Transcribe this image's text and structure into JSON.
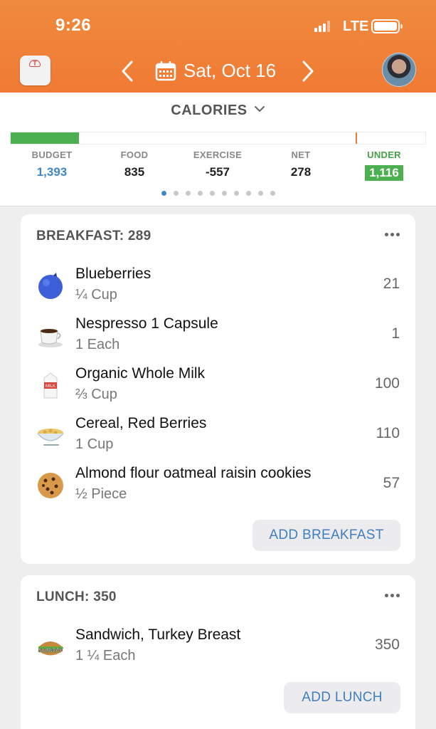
{
  "status_bar": {
    "time": "9:26",
    "network": "LTE"
  },
  "header": {
    "date": "Sat, Oct 16",
    "icons": [
      "scale-icon",
      "chevron-left-icon",
      "calendar-icon",
      "chevron-right-icon",
      "avatar"
    ]
  },
  "summary": {
    "title": "CALORIES",
    "progress_fraction": 0.165,
    "stats": [
      {
        "label": "BUDGET",
        "value": "1,393"
      },
      {
        "label": "FOOD",
        "value": "835"
      },
      {
        "label": "EXERCISE",
        "value": "-557"
      },
      {
        "label": "NET",
        "value": "278"
      },
      {
        "label": "UNDER",
        "value": "1,116"
      }
    ],
    "page_dots": 10,
    "active_dot": 0
  },
  "breakfast": {
    "title": "BREAKFAST: 289",
    "items": [
      {
        "name": "Blueberries",
        "serving": "¼ Cup",
        "calories": "21",
        "icon": "blueberry-icon"
      },
      {
        "name": "Nespresso 1 Capsule",
        "serving": "1 Each",
        "calories": "1",
        "icon": "coffee-cup-icon"
      },
      {
        "name": "Organic Whole Milk",
        "serving": "⅔ Cup",
        "calories": "100",
        "icon": "milk-carton-icon"
      },
      {
        "name": "Cereal, Red Berries",
        "serving": "1 Cup",
        "calories": "110",
        "icon": "cereal-bowl-icon"
      },
      {
        "name": "Almond flour oatmeal raisin cookies",
        "serving": "½ Piece",
        "calories": "57",
        "icon": "cookie-icon"
      }
    ],
    "add_label": "ADD BREAKFAST"
  },
  "lunch": {
    "title": "LUNCH: 350",
    "items": [
      {
        "name": "Sandwich, Turkey Breast",
        "serving": "1 ¼ Each",
        "calories": "350",
        "icon": "sandwich-icon"
      }
    ],
    "add_label": "ADD LUNCH",
    "brand_text": "SUBWAY"
  },
  "colors": {
    "header": "#f07a34",
    "accent_blue": "#3f88c5",
    "under_green": "#4caf50"
  }
}
